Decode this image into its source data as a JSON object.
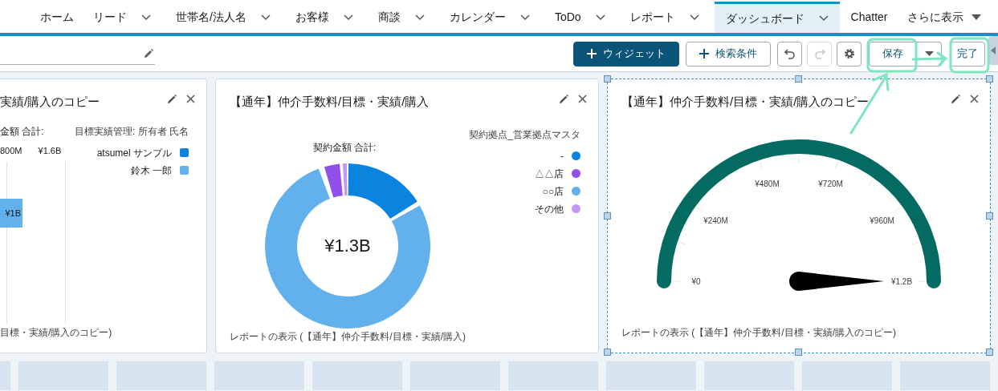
{
  "nav": {
    "items": [
      {
        "label": "ホーム",
        "dropdown": false,
        "selected": false
      },
      {
        "label": "リード",
        "dropdown": true,
        "selected": false
      },
      {
        "label": "世帯名/法人名",
        "dropdown": true,
        "selected": false
      },
      {
        "label": "お客様",
        "dropdown": true,
        "selected": false
      },
      {
        "label": "商談",
        "dropdown": true,
        "selected": false
      },
      {
        "label": "カレンダー",
        "dropdown": true,
        "selected": false
      },
      {
        "label": "ToDo",
        "dropdown": true,
        "selected": false
      },
      {
        "label": "レポート",
        "dropdown": true,
        "selected": false
      },
      {
        "label": "ダッシュボード",
        "dropdown": true,
        "selected": true
      },
      {
        "label": "Chatter",
        "dropdown": false,
        "selected": false
      }
    ],
    "more": {
      "label": "さらに表示"
    }
  },
  "toolbar": {
    "buttons": [
      {
        "kind": "primary",
        "label": "ウィジェット",
        "disabled": false
      },
      {
        "kind": "add",
        "label": "検索条件",
        "disabled": false
      },
      {
        "kind": "undo",
        "disabled": false
      },
      {
        "kind": "redo",
        "disabled": true
      },
      {
        "kind": "settings",
        "disabled": false
      },
      {
        "kind": "save",
        "label": "保存",
        "disabled": false
      },
      {
        "kind": "menu",
        "disabled": false
      },
      {
        "kind": "done",
        "label": "完了",
        "disabled": false
      }
    ]
  },
  "widgets": [
    {
      "kind": "bar",
      "selected": false,
      "title": "実績/購入のコピー",
      "measure_label": "金額 合計:",
      "axis_ticks": [
        "800M",
        "¥1.6B"
      ],
      "bar_label": "¥1B",
      "legend_title": "目標実績管理: 所有者 氏名",
      "legend": [
        {
          "label": "atsumel サンプル",
          "color": "#0b84e0"
        },
        {
          "label": "鈴木 一郎",
          "color": "#62b0ec"
        }
      ],
      "footer": "目標・実績/購入のコピー)"
    },
    {
      "kind": "donut",
      "selected": false,
      "title": "【通年】仲介手数料/目標・実績/購入",
      "measure_label": "契約金額 合計:",
      "total": "¥1.3B",
      "legend_title": "契約拠点_営業拠点マスタ",
      "legend": [
        {
          "label": "-",
          "color": "#0b84e0"
        },
        {
          "label": "△△店",
          "color": "#9050e9"
        },
        {
          "label": "○○店",
          "color": "#62b0ec"
        },
        {
          "label": "その他",
          "color": "#c398f5"
        }
      ],
      "footer": "レポートの表示 (【通年】仲介手数料/目標・実績/購入)"
    },
    {
      "kind": "gauge",
      "selected": true,
      "title": "【通年】仲介手数料/目標・実績/購入のコピー",
      "tick_labels": [
        "¥0",
        "¥240M",
        "¥480M",
        "¥720M",
        "¥960M",
        "¥1.2B"
      ],
      "footer": "レポートの表示 (【通年】仲介手数料/目標・実績/購入のコピー)"
    }
  ]
}
